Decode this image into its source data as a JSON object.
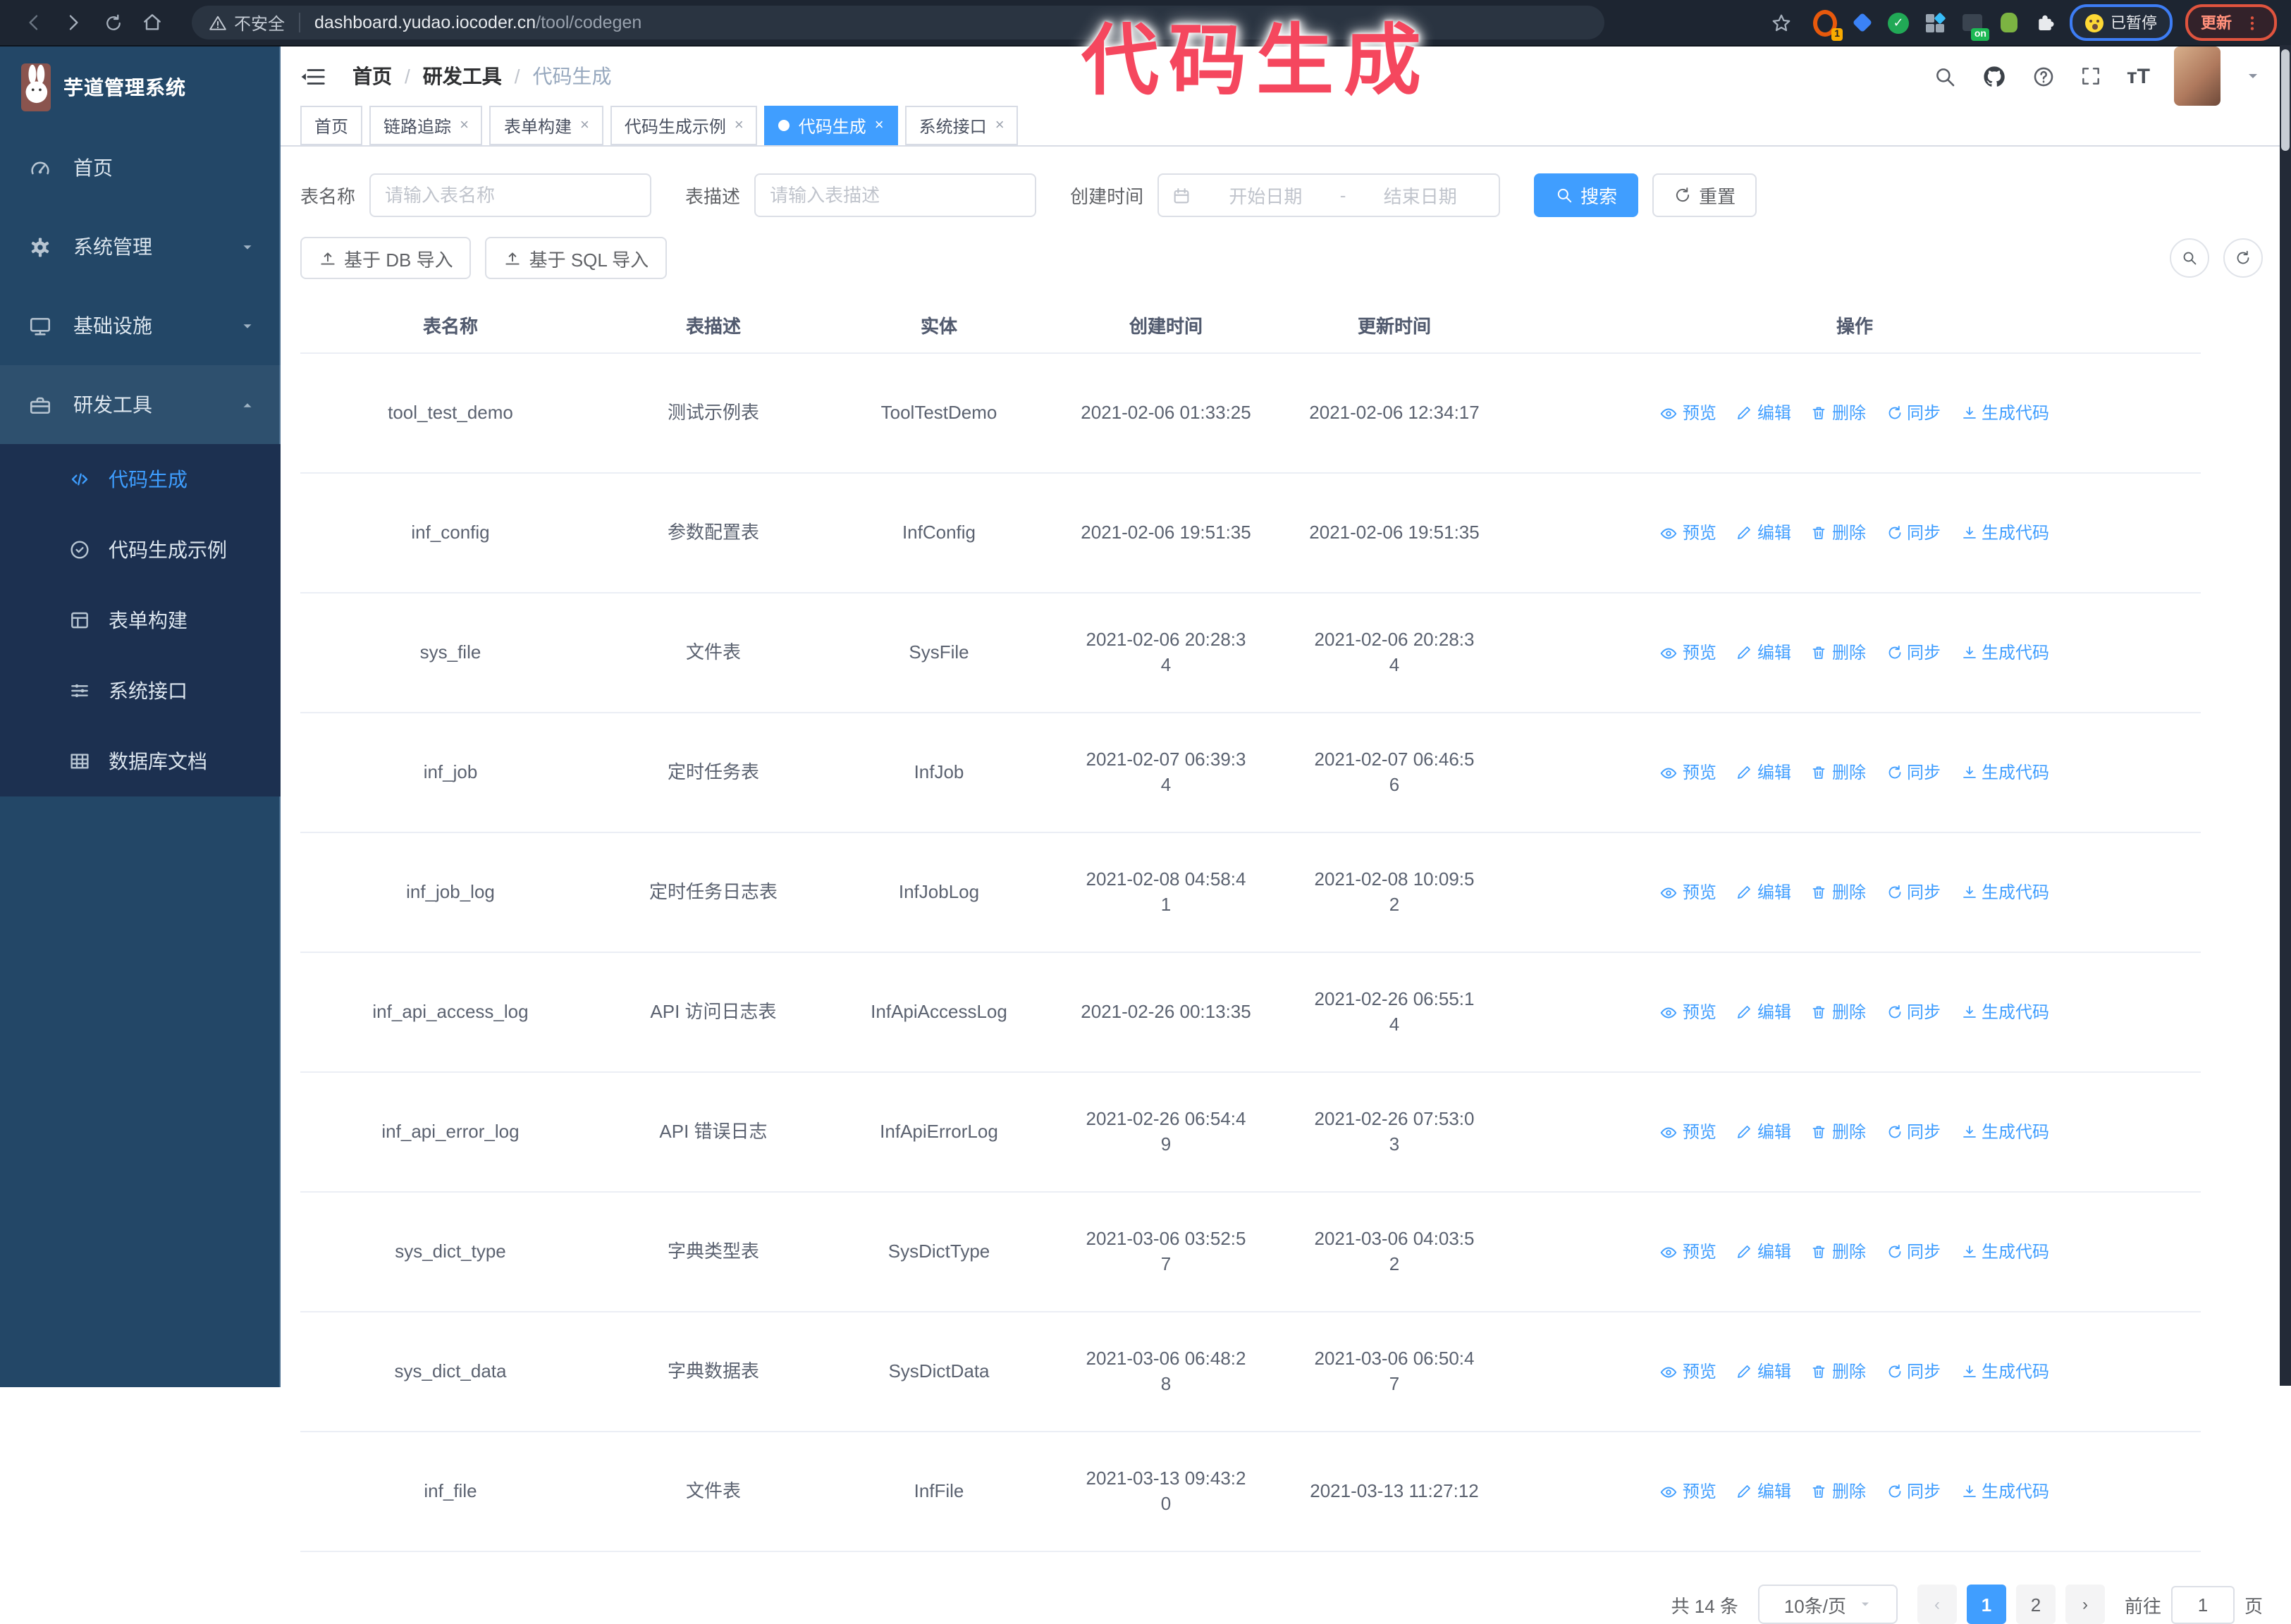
{
  "browser": {
    "security_label": "不安全",
    "url_host": "dashboard.yudao.iocoder.cn",
    "url_path": "/tool/codegen",
    "extension_badge_1": "1",
    "extension_badge_on": "on",
    "paused_badge": "已暂停",
    "update_button": "更新"
  },
  "annotation": {
    "text": "代码生成"
  },
  "sidebar": {
    "title": "芋道管理系统",
    "items": [
      {
        "label": "首页"
      },
      {
        "label": "系统管理",
        "expandable": true
      },
      {
        "label": "基础设施",
        "expandable": true
      },
      {
        "label": "研发工具",
        "expanded": true
      }
    ],
    "submenu": [
      {
        "label": "代码生成",
        "active": true
      },
      {
        "label": "代码生成示例"
      },
      {
        "label": "表单构建"
      },
      {
        "label": "系统接口"
      },
      {
        "label": "数据库文档"
      }
    ]
  },
  "navbar": {
    "breadcrumb": [
      "首页",
      "研发工具",
      "代码生成"
    ],
    "separator": "/"
  },
  "tabs": [
    {
      "label": "首页",
      "closable": false
    },
    {
      "label": "链路追踪",
      "closable": true
    },
    {
      "label": "表单构建",
      "closable": true
    },
    {
      "label": "代码生成示例",
      "closable": true
    },
    {
      "label": "代码生成",
      "closable": true,
      "active": true
    },
    {
      "label": "系统接口",
      "closable": true
    }
  ],
  "filters": {
    "name_label": "表名称",
    "name_placeholder": "请输入表名称",
    "desc_label": "表描述",
    "desc_placeholder": "请输入表描述",
    "time_label": "创建时间",
    "start_placeholder": "开始日期",
    "range_separator": "-",
    "end_placeholder": "结束日期",
    "search_label": "搜索",
    "reset_label": "重置"
  },
  "toolbar": {
    "import_db_label": "基于 DB 导入",
    "import_sql_label": "基于 SQL 导入"
  },
  "table": {
    "columns": [
      "表名称",
      "表描述",
      "实体",
      "创建时间",
      "更新时间",
      "操作"
    ],
    "actions": [
      "预览",
      "编辑",
      "删除",
      "同步",
      "生成代码"
    ],
    "rows": [
      {
        "name": "tool_test_demo",
        "desc": "测试示例表",
        "entity": "ToolTestDemo",
        "created": "2021-02-06 01:33:25",
        "updated": "2021-02-06 12:34:17"
      },
      {
        "name": "inf_config",
        "desc": "参数配置表",
        "entity": "InfConfig",
        "created": "2021-02-06 19:51:35",
        "updated": "2021-02-06 19:51:35"
      },
      {
        "name": "sys_file",
        "desc": "文件表",
        "entity": "SysFile",
        "created": "2021-02-06 20:28:3\n4",
        "updated": "2021-02-06 20:28:3\n4"
      },
      {
        "name": "inf_job",
        "desc": "定时任务表",
        "entity": "InfJob",
        "created": "2021-02-07 06:39:3\n4",
        "updated": "2021-02-07 06:46:5\n6"
      },
      {
        "name": "inf_job_log",
        "desc": "定时任务日志表",
        "entity": "InfJobLog",
        "created": "2021-02-08 04:58:4\n1",
        "updated": "2021-02-08 10:09:5\n2"
      },
      {
        "name": "inf_api_access_log",
        "desc": "API 访问日志表",
        "entity": "InfApiAccessLog",
        "created": "2021-02-26 00:13:35",
        "updated": "2021-02-26 06:55:1\n4"
      },
      {
        "name": "inf_api_error_log",
        "desc": "API 错误日志",
        "entity": "InfApiErrorLog",
        "created": "2021-02-26 06:54:4\n9",
        "updated": "2021-02-26 07:53:0\n3"
      },
      {
        "name": "sys_dict_type",
        "desc": "字典类型表",
        "entity": "SysDictType",
        "created": "2021-03-06 03:52:5\n7",
        "updated": "2021-03-06 04:03:5\n2"
      },
      {
        "name": "sys_dict_data",
        "desc": "字典数据表",
        "entity": "SysDictData",
        "created": "2021-03-06 06:48:2\n8",
        "updated": "2021-03-06 06:50:4\n7"
      },
      {
        "name": "inf_file",
        "desc": "文件表",
        "entity": "InfFile",
        "created": "2021-03-13 09:43:2\n0",
        "updated": "2021-03-13 11:27:12"
      }
    ]
  },
  "pagination": {
    "total_label": "共 14 条",
    "page_size": "10条/页",
    "prev": "‹",
    "next": "›",
    "pages": [
      "1",
      "2"
    ],
    "goto_label": "前往",
    "goto_value": "1",
    "goto_suffix": "页"
  }
}
